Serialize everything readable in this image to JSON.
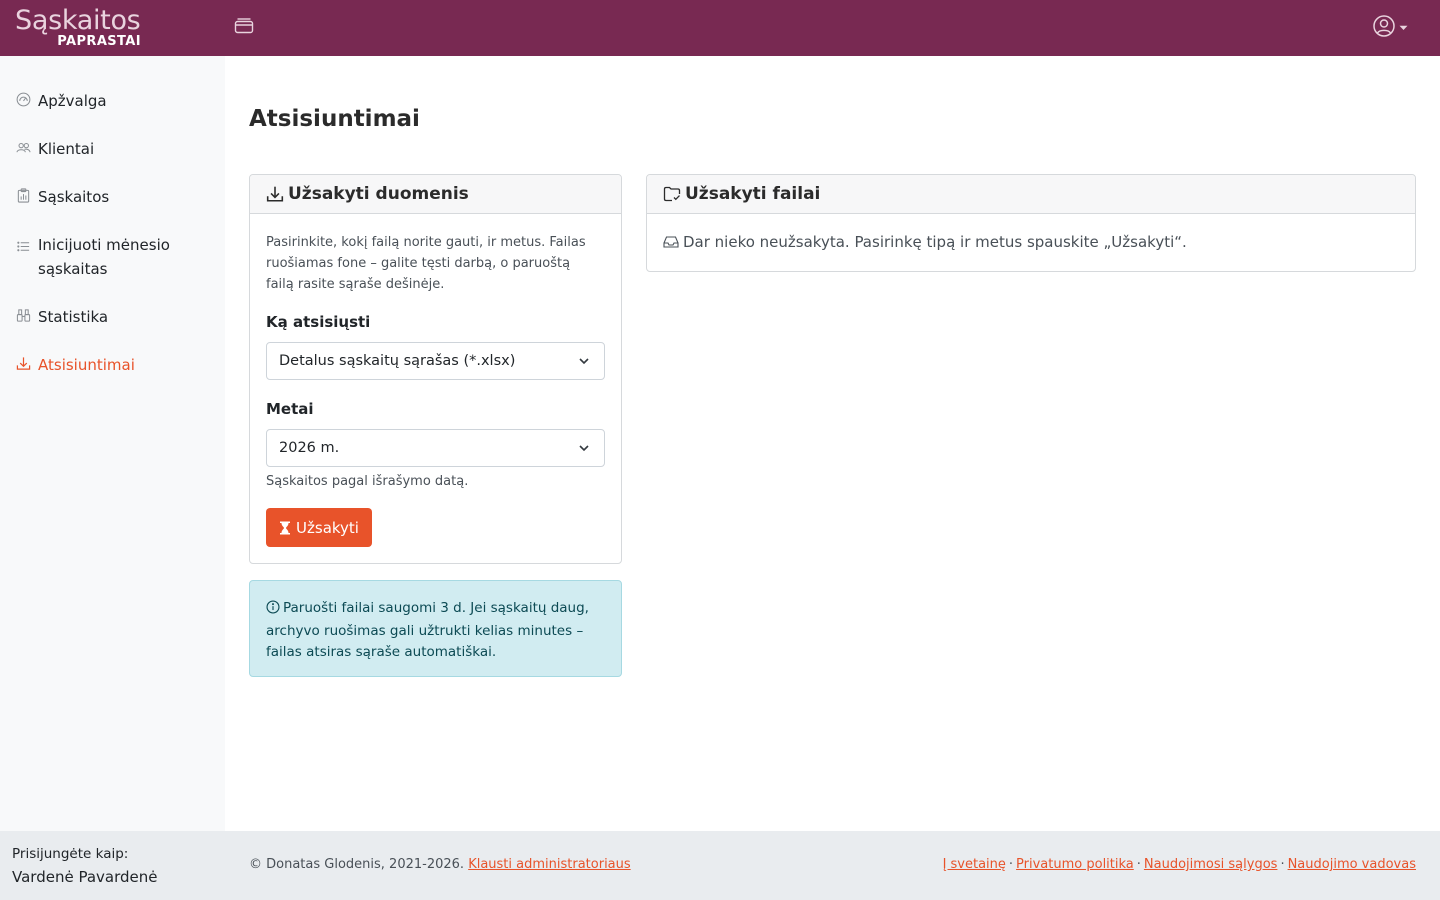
{
  "brand": {
    "main": "Sąskaitos",
    "sub": "PAPRASTAI"
  },
  "sidebar": {
    "items": [
      {
        "label": "Apžvalga",
        "icon": "speedometer-icon"
      },
      {
        "label": "Klientai",
        "icon": "people-icon"
      },
      {
        "label": "Sąskaitos",
        "icon": "clipboard-data-icon"
      },
      {
        "label": "Inicijuoti mėnesio sąskaitas",
        "icon": "list-icon"
      },
      {
        "label": "Statistika",
        "icon": "binoculars-icon"
      },
      {
        "label": "Atsisiuntimai",
        "icon": "download-icon"
      }
    ]
  },
  "page": {
    "title": "Atsisiuntimai"
  },
  "order_card": {
    "title": "Užsakyti duomenis",
    "intro": "Pasirinkite, kokį failą norite gauti, ir metus. Failas ruošiamas fone – galite tęsti darbą, o paruoštą failą rasite sąraše dešinėje.",
    "what_label": "Ką atsisiųsti",
    "what_value": "Detalus sąskaitų sąrašas (*.xlsx)",
    "year_label": "Metai",
    "year_value": "2026 m.",
    "year_help": "Sąskaitos pagal išrašymo datą.",
    "order_button": "Užsakyti"
  },
  "files_card": {
    "title": "Užsakyti failai",
    "empty": "Dar nieko neužsakyta. Pasirinkę tipą ir metus spauskite „Užsakyti“."
  },
  "info_alert": {
    "text": "Paruošti failai saugomi 3 d. Jei sąskaitų daug, archyvo ruošimas gali užtrukti kelias minutes – failas atsiras sąraše automatiškai."
  },
  "footer": {
    "logged_label": "Prisijungėte kaip:",
    "user_name": "Vardenė Pavardenė",
    "copyright": "© Donatas Glodenis, 2021-2026.",
    "ask_admin": "Klausti administratoriaus",
    "links": [
      "Į svetainę",
      "Privatumo politika",
      "Naudojimosi sąlygos",
      "Naudojimo vadovas"
    ]
  },
  "colors": {
    "topbar": "#782952",
    "accent": "#e8532a",
    "sidebar_bg": "#f8f9fa",
    "info_bg": "#d1ecf1"
  }
}
